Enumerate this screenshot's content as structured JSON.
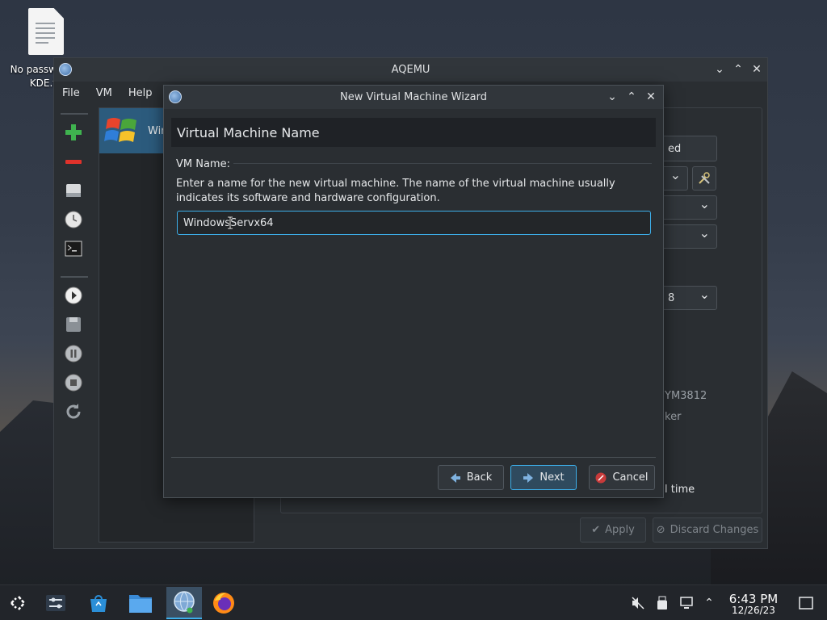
{
  "desktop": {
    "file_label_line1": "No passw",
    "file_label_line2": "KDE.t"
  },
  "main_window": {
    "title": "AQEMU",
    "menu": [
      "File",
      "VM",
      "Help"
    ],
    "vm_list": [
      {
        "label": "Win"
      }
    ],
    "right_panel": {
      "button_partial": "ed",
      "text_partial_1": "YM3812",
      "text_partial_2": "ker",
      "text_partial_3": "l time",
      "combo_partial": "8"
    },
    "apply_label": "Apply",
    "discard_label": "Discard Changes"
  },
  "dialog": {
    "title": "New Virtual Machine Wizard",
    "header": "Virtual Machine Name",
    "vm_name_label": "VM Name:",
    "description": "Enter a name for the new virtual machine. The name of the virtual machine usually indicates its software and hardware configuration.",
    "vm_name_value": "WindowsServx64",
    "back_label": "Back",
    "next_label": "Next",
    "cancel_label": "Cancel"
  },
  "taskbar": {
    "time": "6:43 PM",
    "date": "12/26/23"
  },
  "colors": {
    "accent": "#3daee9",
    "window_bg": "#2a2e32",
    "titlebar_bg": "#31363b",
    "selection": "#2c5b7d"
  }
}
